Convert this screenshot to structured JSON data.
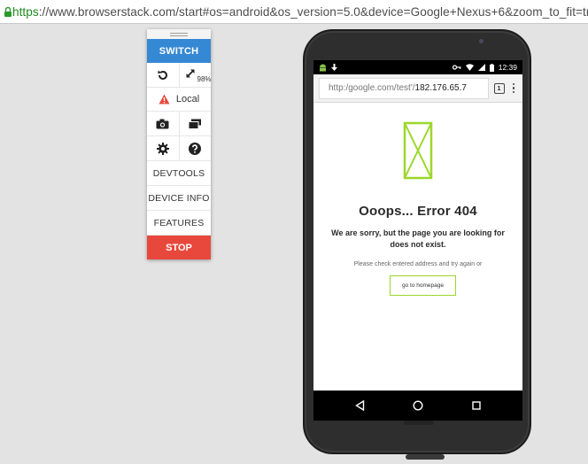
{
  "browser": {
    "url_scheme": "https",
    "url_rest": "://www.browserstack.com/start#os=android&os_version=5.0&device=Google+Nexus+6&zoom_to_fit=true&"
  },
  "panel": {
    "switch_label": "SWITCH",
    "zoom_value": "98%",
    "local_label": "Local",
    "devtools_label": "DEVTOOLS",
    "device_info_label": "DEVICE INFO",
    "features_label": "FEATURES",
    "stop_label": "STOP",
    "colors": {
      "switch": "#3588d3",
      "stop": "#e8483c",
      "warning": "#e8483c"
    }
  },
  "device": {
    "status_time": "12:39",
    "omnibox_prefix": "http:/google.com/test'/",
    "omnibox_host": "182.176.65.7",
    "tab_count": "1",
    "error": {
      "title": "Ooops... Error 404",
      "message": "We are sorry, but the page you are looking for does not exist.",
      "hint": "Please check entered address and try again or",
      "button_label": "go to homepage",
      "accent": "#9cd72a"
    }
  }
}
